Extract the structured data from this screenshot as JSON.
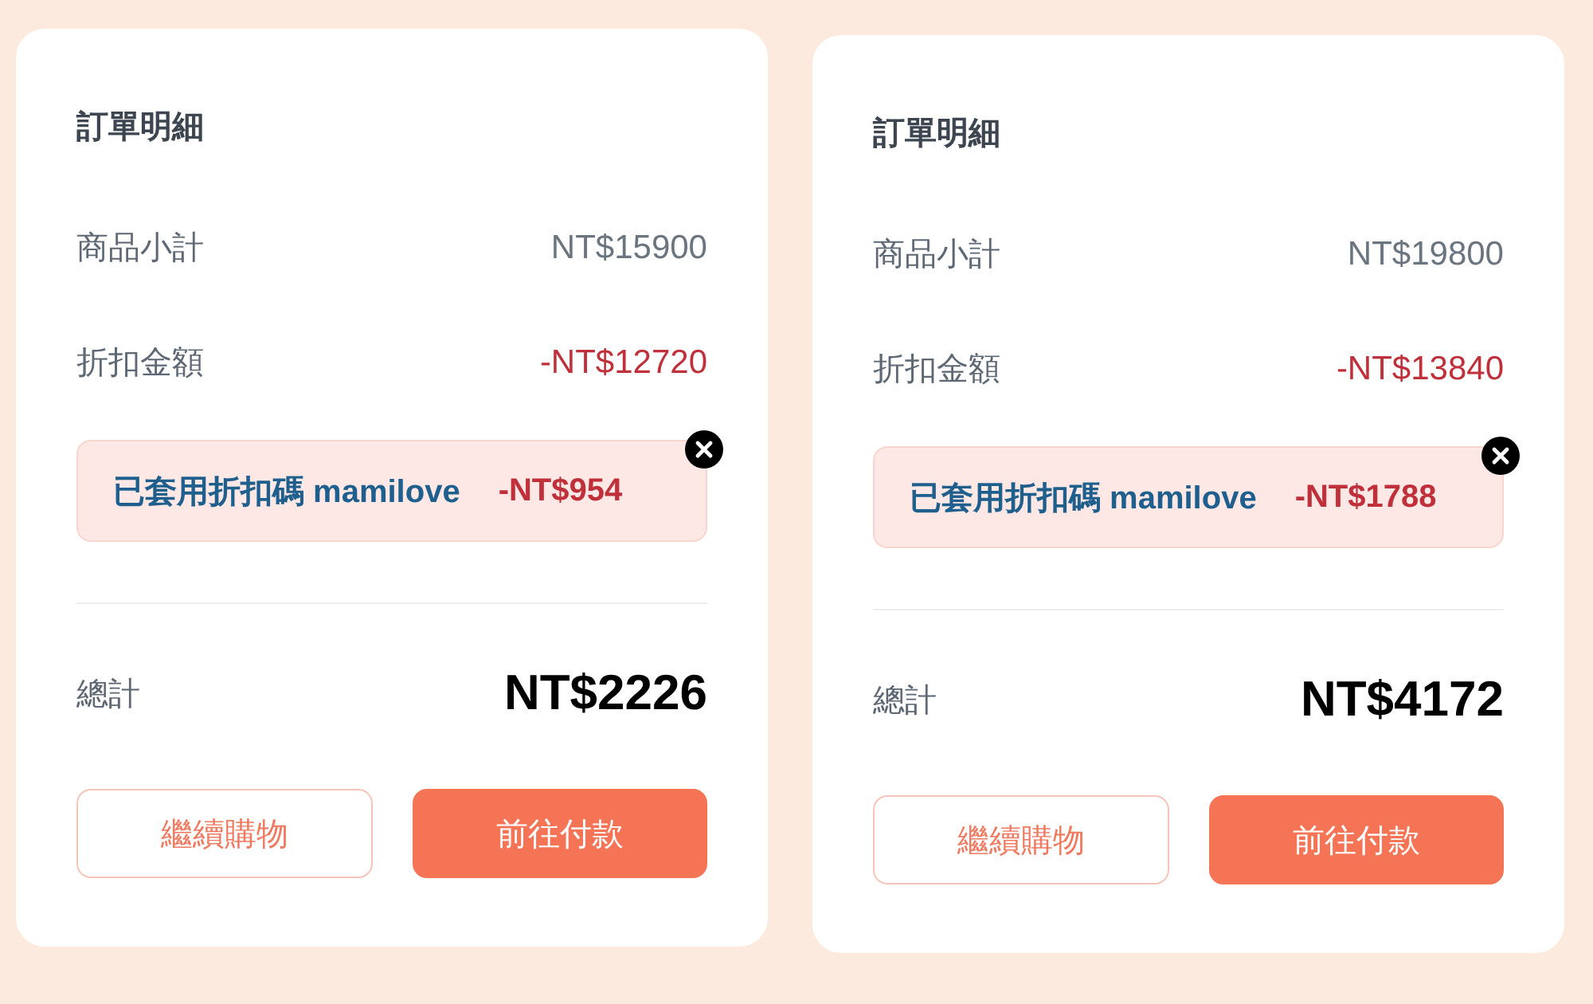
{
  "cards": [
    {
      "title": "訂單明細",
      "subtotal": {
        "label": "商品小計",
        "value": "NT$15900"
      },
      "discount": {
        "label": "折扣金額",
        "value": "-NT$12720"
      },
      "coupon": {
        "text": "已套用折扣碼 mamilove",
        "amount": "-NT$954"
      },
      "total": {
        "label": "總計",
        "value": "NT$2226"
      },
      "buttons": [
        {
          "label": "繼續購物",
          "kind": "outline"
        },
        {
          "label": "前往付款",
          "kind": "primary"
        }
      ]
    },
    {
      "title": "訂單明細",
      "subtotal": {
        "label": "商品小計",
        "value": "NT$19800"
      },
      "discount": {
        "label": "折扣金額",
        "value": "-NT$13840"
      },
      "coupon": {
        "text": "已套用折扣碼 mamilove",
        "amount": "-NT$1788"
      },
      "total": {
        "label": "總計",
        "value": "NT$4172"
      },
      "buttons": [
        {
          "label": "繼續購物",
          "kind": "outline"
        },
        {
          "label": "前往付款",
          "kind": "primary"
        }
      ]
    }
  ]
}
